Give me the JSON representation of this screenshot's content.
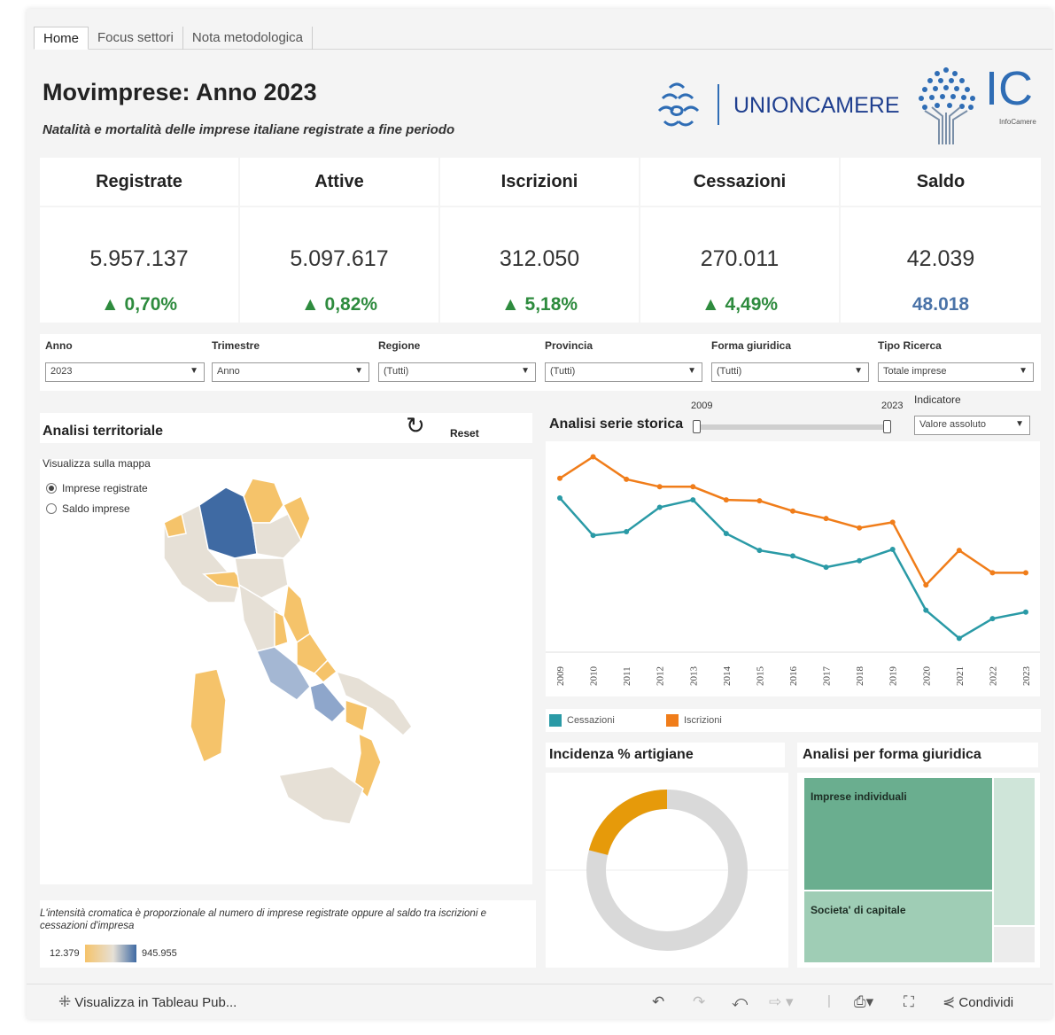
{
  "tabs": [
    "Home",
    "Focus settori",
    "Nota metodologica"
  ],
  "header": {
    "title": "Movimprese: Anno 2023",
    "subtitle": "Natalità e mortalità delle imprese italiane registrate a fine periodo",
    "logo_unioncamere": "UNIONCAMERE",
    "logo_ic": "IC",
    "logo_ic_sub": "InfoCamere"
  },
  "kpis": [
    {
      "label": "Registrate",
      "value": "5.957.137",
      "delta": "▲ 0,70%"
    },
    {
      "label": "Attive",
      "value": "5.097.617",
      "delta": "▲ 0,82%"
    },
    {
      "label": "Iscrizioni",
      "value": "312.050",
      "delta": "▲ 5,18%"
    },
    {
      "label": "Cessazioni",
      "value": "270.011",
      "delta": "▲ 4,49%"
    },
    {
      "label": "Saldo",
      "value": "42.039",
      "delta": "48.018"
    }
  ],
  "filters": [
    {
      "label": "Anno",
      "value": "2023"
    },
    {
      "label": "Trimestre",
      "value": "Anno"
    },
    {
      "label": "Regione",
      "value": "(Tutti)"
    },
    {
      "label": "Provincia",
      "value": "(Tutti)"
    },
    {
      "label": "Forma giuridica",
      "value": "(Tutti)"
    },
    {
      "label": "Tipo Ricerca",
      "value": "Totale imprese"
    }
  ],
  "territorial": {
    "title": "Analisi territoriale",
    "reset": "Reset",
    "map_label": "Visualizza sulla mappa",
    "options": [
      "Imprese registrate",
      "Saldo imprese"
    ],
    "note": "L'intensità cromatica è proporzionale al numero di imprese registrate oppure al saldo tra iscrizioni e cessazioni d'impresa",
    "scale_min": "12.379",
    "scale_max": "945.955",
    "colors": {
      "low": "#f5c36a",
      "mid": "#e6e0d6",
      "high": "#3f6aa3"
    }
  },
  "series": {
    "title": "Analisi serie storica",
    "range_start": "2009",
    "range_end": "2023",
    "indicator_label": "Indicatore",
    "indicator_value": "Valore assoluto"
  },
  "chart_data": {
    "type": "line",
    "x": [
      "2009",
      "2010",
      "2011",
      "2012",
      "2013",
      "2014",
      "2015",
      "2016",
      "2017",
      "2018",
      "2019",
      "2020",
      "2021",
      "2022",
      "2023"
    ],
    "series": [
      {
        "name": "Cessazioni",
        "color": "#2a9aa6",
        "values": [
          392,
          352,
          356,
          382,
          390,
          354,
          336,
          330,
          318,
          325,
          337,
          272,
          242,
          263,
          270
        ]
      },
      {
        "name": "Iscrizioni",
        "color": "#f07d1a",
        "values": [
          413,
          436,
          412,
          404,
          404,
          390,
          389,
          378,
          370,
          360,
          366,
          299,
          336,
          312,
          312
        ]
      }
    ],
    "ylim": [
      230,
      445
    ]
  },
  "artigiane": {
    "title": "Incidenza % artigiane",
    "share": 0.21,
    "colors": {
      "share": "#e69a0a",
      "rest": "#d9d9d9"
    }
  },
  "forma": {
    "title": "Analisi per forma giuridica",
    "labels": [
      "Imprese individuali",
      "Societa' di capitale"
    ],
    "colors": {
      "a": "#6aae8f",
      "b": "#9fcdb5",
      "c": "#cfe5d9",
      "d": "#ececec"
    }
  },
  "bottombar": {
    "view": "Visualizza in Tableau Pub...",
    "share": "Condividi"
  }
}
